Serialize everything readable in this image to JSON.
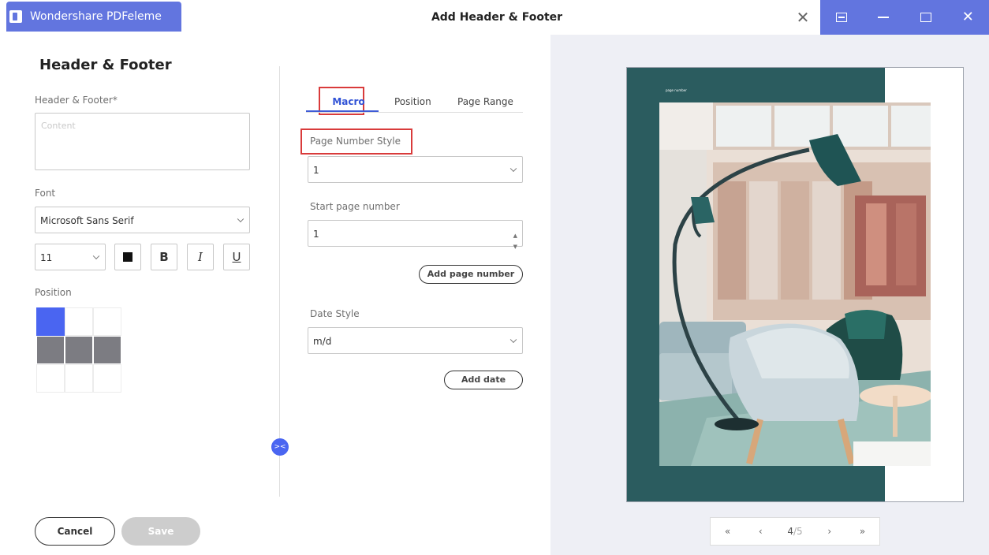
{
  "window": {
    "app_name": "Wondershare PDFeleme",
    "dialog_title": "Add Header  & Footer",
    "accent": "#6275df"
  },
  "left": {
    "title": "Header & Footer",
    "content_label": "Header & Footer*",
    "content_placeholder": "Content",
    "font_label": "Font",
    "font_value": "Microsoft Sans Serif",
    "size_value": "11",
    "text_color": "#000000",
    "format_buttons": {
      "bold": "B",
      "italic": "I",
      "underline": "U"
    },
    "position_label": "Position",
    "position_grid": {
      "selected": "top-left",
      "highlighted_row": "middle"
    }
  },
  "tabs": {
    "macro": "Macro",
    "position": "Position",
    "page_range": "Page Range",
    "active": "Macro"
  },
  "macro": {
    "page_number_style_label": "Page Number Style",
    "page_number_style_value": "1",
    "start_page_label": "Start page number",
    "start_page_value": "1",
    "add_page_number_btn": "Add page number",
    "date_style_label": "Date Style",
    "date_style_value": "m/d",
    "add_date_btn": "Add date"
  },
  "buttons": {
    "cancel": "Cancel",
    "save": "Save"
  },
  "preview": {
    "header_text": "page number",
    "current_page": "4",
    "total_pages": "/5",
    "nav": {
      "first": "«",
      "prev": "‹",
      "next": "›",
      "last": "»"
    }
  },
  "icons": {
    "app_logo": "pdfelement-logo-icon",
    "close": "close-icon",
    "chevron": "chevron-down-icon",
    "spin": "stepper-icon",
    "toggle": "collapse-arrows-icon"
  },
  "colors": {
    "title_bar": "#6275df",
    "selected_cell": "#4a65f1",
    "row_cell": "#7c7c82",
    "highlight_frame": "#d93b3b",
    "preview_teal": "#2b5c5f",
    "preview_bg": "#eeeff5"
  }
}
